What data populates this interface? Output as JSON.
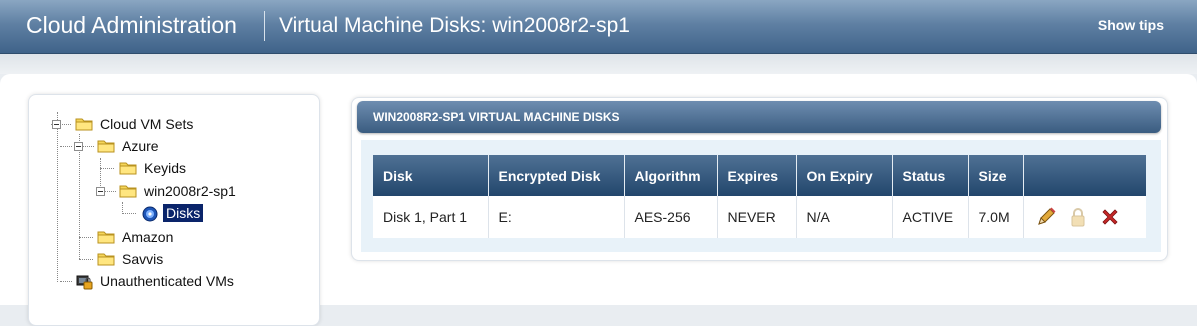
{
  "header": {
    "app_title": "Cloud Administration",
    "page_title": "Virtual Machine Disks: win2008r2-sp1",
    "show_tips": "Show tips"
  },
  "tree": {
    "root": "Cloud VM Sets",
    "azure": "Azure",
    "keyids": "Keyids",
    "vm": "win2008r2-sp1",
    "disks": "Disks",
    "amazon": "Amazon",
    "savvis": "Savvis",
    "unauth": "Unauthenticated VMs"
  },
  "panel": {
    "title": "WIN2008R2-SP1 VIRTUAL MACHINE DISKS"
  },
  "table": {
    "headers": [
      "Disk",
      "Encrypted Disk",
      "Algorithm",
      "Expires",
      "On Expiry",
      "Status",
      "Size",
      ""
    ],
    "rows": [
      {
        "disk": "Disk 1, Part 1",
        "encrypted": "E:",
        "algorithm": "AES-256",
        "expires": "NEVER",
        "on_expiry": "N/A",
        "status": "ACTIVE",
        "size": "7.0M",
        "actions": [
          "pencil-icon",
          "lock-icon",
          "delete-icon"
        ]
      }
    ]
  },
  "colors": {
    "header_top": "#8aa6c2",
    "header_bottom": "#3f6389",
    "selection": "#0a246a",
    "delete_red": "#c62828"
  }
}
